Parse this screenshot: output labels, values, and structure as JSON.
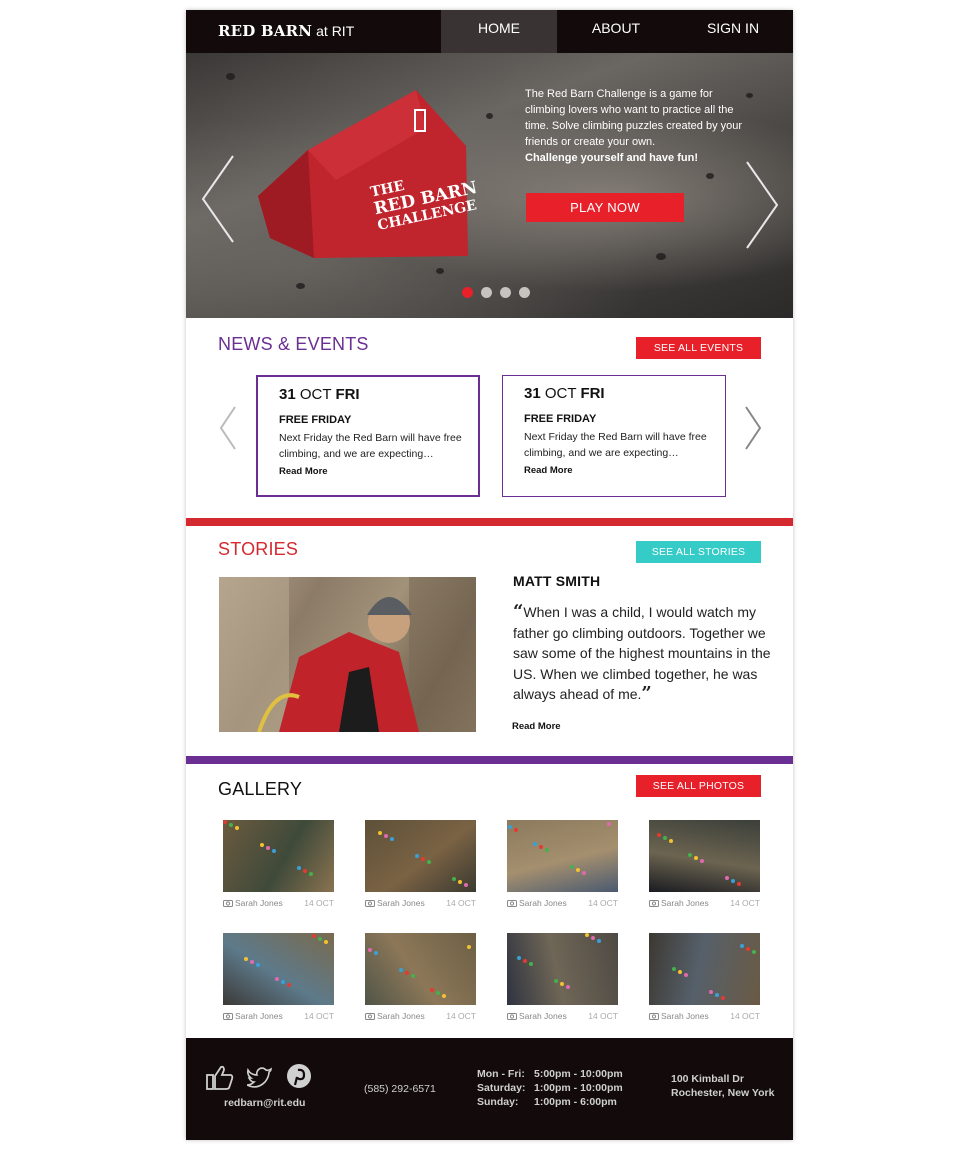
{
  "nav": {
    "brand_bold": "RED BARN",
    "brand_rest": " at RIT",
    "items": [
      {
        "label": "HOME"
      },
      {
        "label": "ABOUT"
      },
      {
        "label": "SIGN IN"
      }
    ]
  },
  "hero": {
    "barn_title_line1": "THE",
    "barn_title_line2": "RED BARN",
    "barn_title_line3": "CHALLENGE",
    "text": "The Red Barn Challenge is a game for climbing lovers who want to practice all the time. Solve climbing puzzles created by your friends or create your own.",
    "text_bold": "Challenge yourself and have fun!",
    "cta": "PLAY NOW",
    "slide_count": 4,
    "active_slide": 1
  },
  "news": {
    "title": "NEWS & EVENTS",
    "see_all": "SEE ALL EVENTS",
    "events": [
      {
        "day": "31",
        "month": "OCT",
        "weekday": "FRI",
        "title": "FREE FRIDAY",
        "desc": "Next Friday the Red Barn will have free climbing, and we are expecting…",
        "more": "Read More"
      },
      {
        "day": "31",
        "month": "OCT",
        "weekday": "FRI",
        "title": "FREE FRIDAY",
        "desc": "Next Friday the Red Barn will have free climbing, and we are expecting…",
        "more": "Read More"
      }
    ]
  },
  "stories": {
    "title": "STORIES",
    "see_all": "SEE ALL STORIES",
    "name": "MATT SMITH",
    "quote": "When I was a child, I would watch my father go climbing outdoors. Together we saw some of the highest mountains in the US. When we climbed together, he was always ahead of me.",
    "open_quote": "“",
    "close_quote": "”",
    "more": "Read More"
  },
  "gallery": {
    "title": "GALLERY",
    "see_all": "SEE ALL PHOTOS",
    "photos": [
      {
        "author": "Sarah Jones",
        "date": "14 OCT"
      },
      {
        "author": "Sarah Jones",
        "date": "14 OCT"
      },
      {
        "author": "Sarah Jones",
        "date": "14 OCT"
      },
      {
        "author": "Sarah Jones",
        "date": "14 OCT"
      },
      {
        "author": "Sarah Jones",
        "date": "14 OCT"
      },
      {
        "author": "Sarah Jones",
        "date": "14 OCT"
      },
      {
        "author": "Sarah Jones",
        "date": "14 OCT"
      },
      {
        "author": "Sarah Jones",
        "date": "14 OCT"
      }
    ]
  },
  "footer": {
    "email": "redbarn@rit.edu",
    "phone": "(585) 292-6571",
    "hours": [
      {
        "days": "Mon - Fri:",
        "time": "5:00pm - 10:00pm"
      },
      {
        "days": "Saturday:",
        "time": "1:00pm - 10:00pm"
      },
      {
        "days": "Sunday:",
        "time": "1:00pm - 6:00pm"
      }
    ],
    "address_line1": "100 Kimball Dr",
    "address_line2": "Rochester, New York",
    "social": [
      "like-icon",
      "twitter-icon",
      "pinterest-icon"
    ]
  },
  "colors": {
    "accent_red": "#e8202a",
    "purple": "#6b2f93",
    "teal": "#35cbc7",
    "dark": "#120a0b",
    "stories_red": "#d42a2f"
  }
}
